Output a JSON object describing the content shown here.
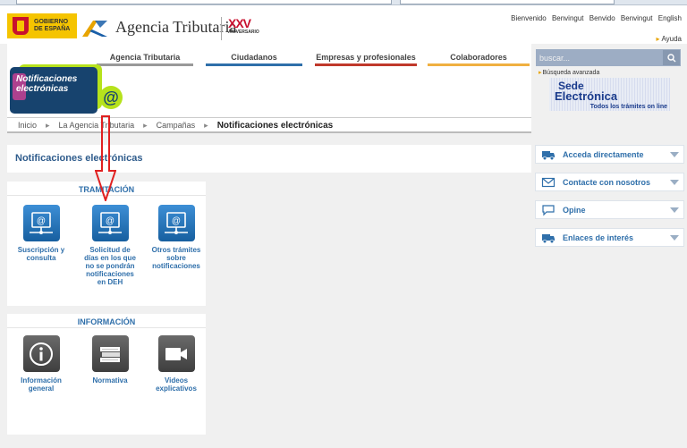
{
  "header": {
    "gob_line1": "GOBIERNO",
    "gob_line2": "DE ESPAÑA",
    "title": "Agencia Tributaria",
    "xxv": "XXV",
    "xxv_sub": "ANIVERSARIO",
    "lang_links": [
      "Bienvenido",
      "Benvingut",
      "Benvido",
      "Benvingut",
      "English"
    ],
    "help": "Ayuda"
  },
  "nav": {
    "items": [
      {
        "label": "Agencia Tributaria",
        "color": "#999999"
      },
      {
        "label": "Ciudadanos",
        "color": "#2f6faa"
      },
      {
        "label": "Empresas y profesionales",
        "color": "#c0392b"
      },
      {
        "label": "Colaboradores",
        "color": "#f0b040"
      }
    ]
  },
  "search": {
    "placeholder": "buscar...",
    "advanced": "Búsqueda avanzada"
  },
  "sede": {
    "line1": "Sede",
    "line2": "Electrónica",
    "line3": "Todos los trámites on line"
  },
  "banner": {
    "line1": "Notificaciones",
    "line2": "electrónicas",
    "at": "@"
  },
  "breadcrumb": {
    "items": [
      "Inicio",
      "La Agencia Tributaria",
      "Campañas"
    ],
    "current": "Notificaciones electrónicas"
  },
  "page_title": "Notificaciones electrónicas",
  "tramitacion": {
    "heading": "TRAMITACIÓN",
    "items": [
      {
        "label": "Suscripción y consulta",
        "icon": "computer-icon"
      },
      {
        "label": "Solicitud de días en los que no se pondrán notificaciones en DEH",
        "icon": "computer-icon"
      },
      {
        "label": "Otros trámites sobre notificaciones",
        "icon": "computer-icon"
      }
    ]
  },
  "informacion": {
    "heading": "INFORMACIÓN",
    "items": [
      {
        "label": "Información general",
        "icon": "info-icon"
      },
      {
        "label": "Normativa",
        "icon": "books-icon"
      },
      {
        "label": "Videos explicativos",
        "icon": "video-camera-icon"
      }
    ]
  },
  "right_menu": [
    {
      "label": "Acceda directamente",
      "icon": "truck-icon"
    },
    {
      "label": "Contacte con nosotros",
      "icon": "envelope-icon"
    },
    {
      "label": "Opine",
      "icon": "speech-bubble-icon"
    },
    {
      "label": "Enlaces de interés",
      "icon": "truck-icon"
    }
  ],
  "colors": {
    "accent_blue": "#2f6faa",
    "dark_blue": "#17436e",
    "lime": "#b6e21c",
    "gob_yellow": "#f5c400"
  }
}
